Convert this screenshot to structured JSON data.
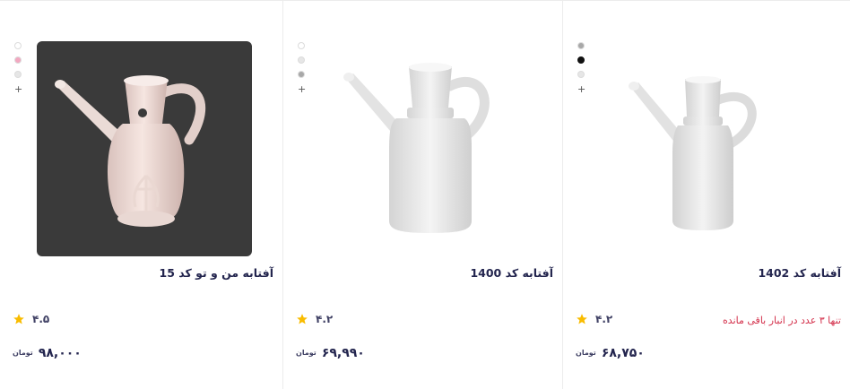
{
  "colors": {
    "accent_star": "#f9bc00",
    "stock_warning": "#d32f4a",
    "text": "#23254e"
  },
  "products": [
    {
      "title": "آفتابه من و تو کد 15",
      "swatches": [
        "#ffffff",
        "#f2a7c0",
        "#e6e6e6"
      ],
      "more_label": "+",
      "rating": "۴.۵",
      "price": "۹۸,۰۰۰",
      "currency": "تومان",
      "stock_note": "",
      "image_icon": "pink-ewer-image"
    },
    {
      "title": "آفتابه کد 1400",
      "swatches": [
        "#ffffff",
        "#e6e6e6",
        "#a8a8a8"
      ],
      "more_label": "+",
      "rating": "۴.۲",
      "price": "۶۹,۹۹۰",
      "currency": "تومان",
      "stock_note": "",
      "image_icon": "white-ewer-image"
    },
    {
      "title": "آفتابه کد 1402",
      "swatches": [
        "#a8a8a8",
        "#111111",
        "#e6e6e6"
      ],
      "more_label": "+",
      "rating": "۴.۲",
      "price": "۶۸,۷۵۰",
      "currency": "تومان",
      "stock_note": "تنها ۳ عدد در انبار باقی مانده",
      "image_icon": "white-ewer-image"
    }
  ]
}
